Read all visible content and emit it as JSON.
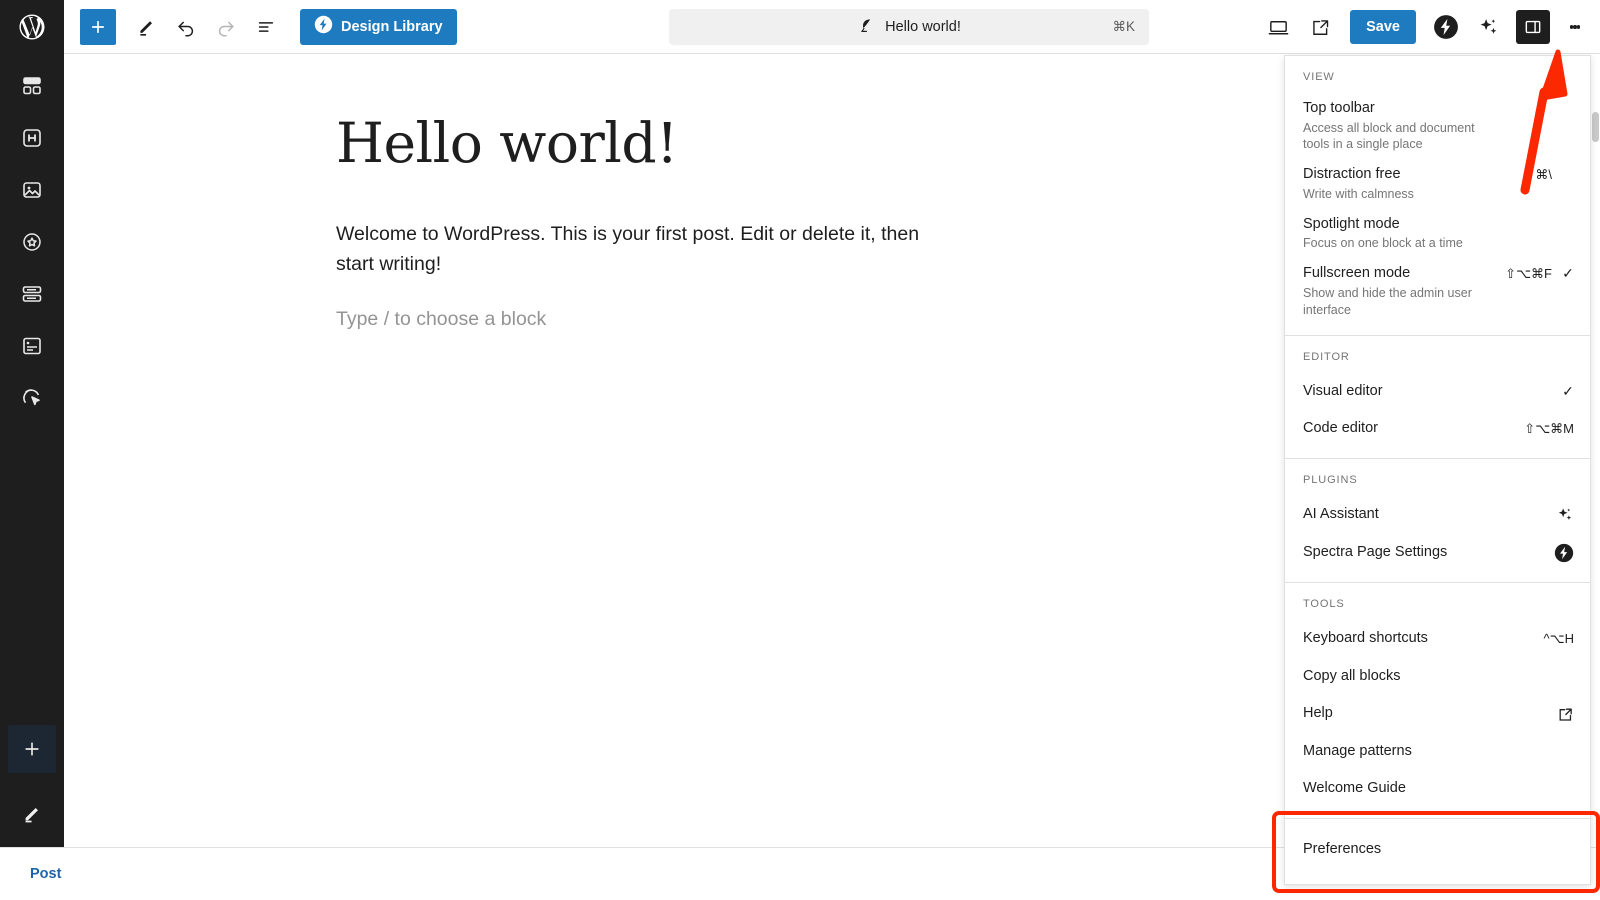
{
  "app": {
    "logo_icon": "wordpress-logo-icon",
    "accent_blue": "#1e7bbf",
    "dark_rail": "#1e1e1e",
    "highlight_red": "#fb2800"
  },
  "rail": {
    "items": [
      {
        "icon": "layout-blocks-icon",
        "name": "sidebar-item-layout"
      },
      {
        "icon": "heading-h-icon",
        "name": "sidebar-item-headings"
      },
      {
        "icon": "image-icon",
        "name": "sidebar-item-images"
      },
      {
        "icon": "star-badge-icon",
        "name": "sidebar-item-star"
      },
      {
        "icon": "stacked-rows-icon",
        "name": "sidebar-item-rows"
      },
      {
        "icon": "card-content-icon",
        "name": "sidebar-item-card"
      },
      {
        "icon": "cursor-click-icon",
        "name": "sidebar-item-interactions"
      }
    ],
    "add_icon": "plus-icon",
    "edit_icon": "pencil-icon"
  },
  "toolbar": {
    "add_block_icon": "plus-icon",
    "tools_icon": "pencil-edit-icon",
    "undo_icon": "undo-arrow-icon",
    "redo_icon": "redo-arrow-icon",
    "list_view_icon": "document-outline-icon",
    "design_library_label": "Design Library",
    "design_library_icon": "spectra-bolt-icon",
    "preview_icon": "desktop-preview-icon",
    "view_external_icon": "external-link-icon",
    "save_label": "Save",
    "spectra_icon": "spectra-bolt-icon",
    "ai_sparkle_icon": "sparkles-icon",
    "settings_sidebar_icon": "sidebar-panel-icon",
    "options_kebab_icon": "vertical-dots-icon"
  },
  "command_bar": {
    "icon": "feather-quill-icon",
    "title": "Hello world!",
    "shortcut": "⌘K"
  },
  "content": {
    "title": "Hello world!",
    "paragraph": "Welcome to WordPress. This is your first post. Edit or delete it, then start writing!",
    "placeholder": "Type / to choose a block"
  },
  "bottom_bar": {
    "post_label": "Post"
  },
  "menu": {
    "sections": [
      {
        "label": "View",
        "style": "detailed",
        "items": [
          {
            "title": "Top toolbar",
            "description": "Access all block and document tools in a single place",
            "shortcut": "",
            "checked": false
          },
          {
            "title": "Distraction free",
            "description": "Write with calmness",
            "shortcut": "⇧⌘\\",
            "checked": false
          },
          {
            "title": "Spotlight mode",
            "description": "Focus on one block at a time",
            "shortcut": "",
            "checked": false
          },
          {
            "title": "Fullscreen mode",
            "description": "Show and hide the admin user interface",
            "shortcut": "⇧⌥⌘F",
            "checked": true
          }
        ]
      },
      {
        "label": "Editor",
        "style": "simple",
        "items": [
          {
            "title": "Visual editor",
            "shortcut": "",
            "checked": true,
            "icon": ""
          },
          {
            "title": "Code editor",
            "shortcut": "⇧⌥⌘M",
            "checked": false,
            "icon": ""
          }
        ]
      },
      {
        "label": "Plugins",
        "style": "simple",
        "items": [
          {
            "title": "AI Assistant",
            "shortcut": "",
            "checked": false,
            "icon": "sparkles-icon"
          },
          {
            "title": "Spectra Page Settings",
            "shortcut": "",
            "checked": false,
            "icon": "spectra-bolt-icon"
          }
        ]
      },
      {
        "label": "Tools",
        "style": "simple",
        "items": [
          {
            "title": "Keyboard shortcuts",
            "shortcut": "^⌥H",
            "checked": false,
            "icon": ""
          },
          {
            "title": "Copy all blocks",
            "shortcut": "",
            "checked": false,
            "icon": ""
          },
          {
            "title": "Help",
            "shortcut": "",
            "checked": false,
            "icon": "external-link-icon"
          },
          {
            "title": "Manage patterns",
            "shortcut": "",
            "checked": false,
            "icon": ""
          },
          {
            "title": "Welcome Guide",
            "shortcut": "",
            "checked": false,
            "icon": ""
          }
        ]
      }
    ],
    "preferences": {
      "label": "Preferences",
      "highlighted": true
    }
  },
  "annotation": {
    "arrow_icon": "red-arrow-pointing-up-right",
    "arrow_color": "#fb2800"
  }
}
